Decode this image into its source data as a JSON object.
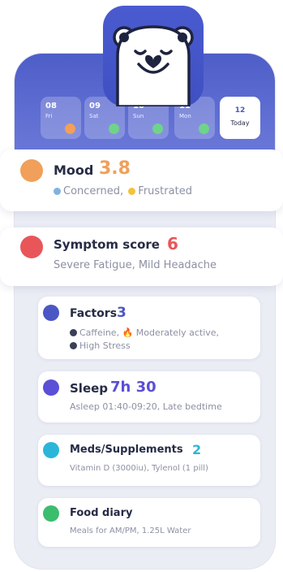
{
  "days": [
    {
      "num": "08",
      "name": "Fri",
      "face": "#f0a05a"
    },
    {
      "num": "09",
      "name": "Sat",
      "face": "#6fd38a"
    },
    {
      "num": "10",
      "name": "Sun",
      "face": "#6fd38a"
    },
    {
      "num": "11",
      "name": "Mon",
      "face": "#6fd38a"
    }
  ],
  "today": {
    "num": "12",
    "label": "Today"
  },
  "mood": {
    "title": "Mood",
    "value": "3.8",
    "items": [
      "Concerned,",
      "Frustrated"
    ],
    "accent": "#f0a05a"
  },
  "symptom": {
    "title": "Symptom score",
    "value": "6",
    "detail": "Severe Fatigue, Mild Headache",
    "accent": "#e8565a"
  },
  "factors": {
    "title": "Factors",
    "value": "3",
    "line1": "Caffeine, 🔥 Moderately active,",
    "line2": "High Stress",
    "accent": "#4b57c4"
  },
  "sleep": {
    "title": "Sleep",
    "value": "7h 30",
    "detail": "Asleep 01:40-09:20,  Late bedtime",
    "accent": "#5a4fd6"
  },
  "meds": {
    "title": "Meds/Supplements",
    "value": "2",
    "detail": "Vitamin D (3000iu), Tylenol (1 pill)",
    "accent": "#2bb6d9"
  },
  "food": {
    "title": "Food diary",
    "detail": "Meals for AM/PM, 1.25L Water",
    "accent": "#3bbd6e"
  }
}
